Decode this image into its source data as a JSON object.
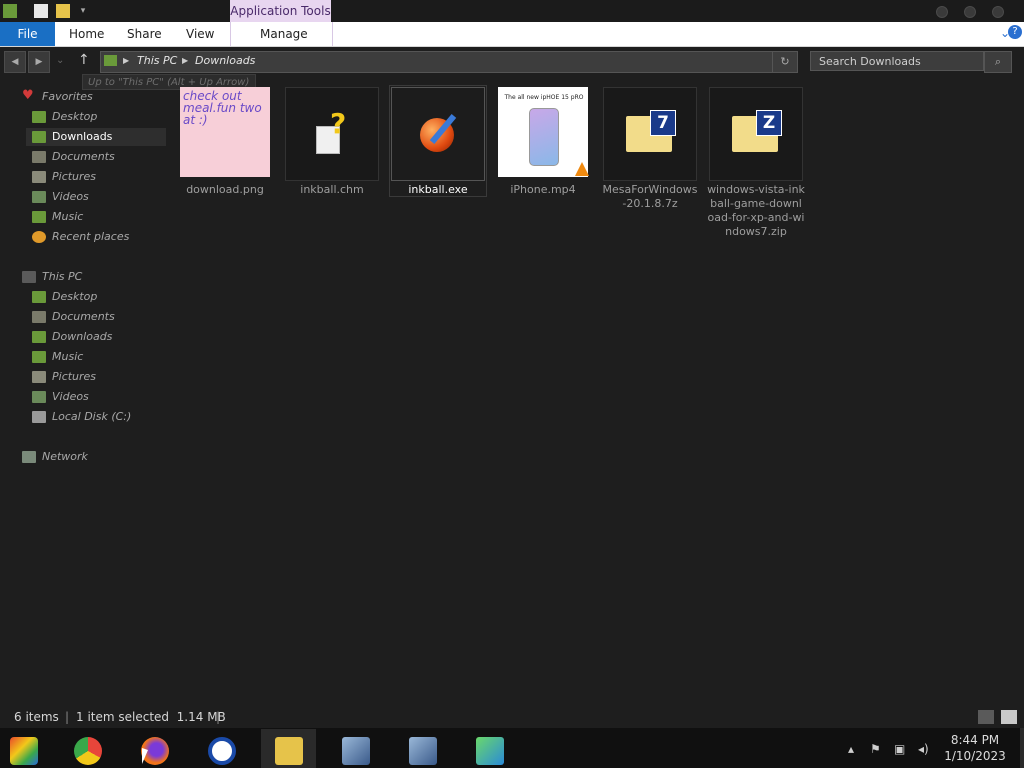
{
  "titlebar": {
    "context_tab": "Application Tools"
  },
  "ribbon": {
    "tabs": [
      "File",
      "Home",
      "Share",
      "View",
      "Manage"
    ]
  },
  "address": {
    "crumbs": [
      "This PC",
      "Downloads"
    ]
  },
  "tooltip": "Up to \"This PC\" (Alt + Up Arrow)",
  "search": {
    "placeholder": "Search Downloads"
  },
  "nav": {
    "favorites_label": "Favorites",
    "favorites": [
      "Desktop",
      "Downloads",
      "Documents",
      "Pictures",
      "Videos",
      "Music",
      "Recent places"
    ],
    "thispc_label": "This PC",
    "thispc": [
      "Desktop",
      "Documents",
      "Downloads",
      "Music",
      "Pictures",
      "Videos",
      "Local Disk (C:)"
    ],
    "network_label": "Network"
  },
  "files": [
    {
      "name": "download.png",
      "thumb_text": "check out meal.fun two at :)"
    },
    {
      "name": "inkball.chm"
    },
    {
      "name": "inkball.exe"
    },
    {
      "name": "iPhone.mp4",
      "thumb_text": "The all new ipHOE 15 pRO"
    },
    {
      "name": "MesaForWindows-20.1.8.7z",
      "badge": "7"
    },
    {
      "name": "windows-vista-inkball-game-download-for-xp-and-windows7.zip",
      "badge": "Z"
    }
  ],
  "status": {
    "count": "6 items",
    "selection": "1 item selected  1.14 MB"
  },
  "clock": {
    "time": "8:44 PM",
    "date": "1/10/2023"
  },
  "colors": {
    "file_tab": "#1a6fc4",
    "context_tab": "#e8d6f0",
    "background": "#1e1e1e"
  }
}
